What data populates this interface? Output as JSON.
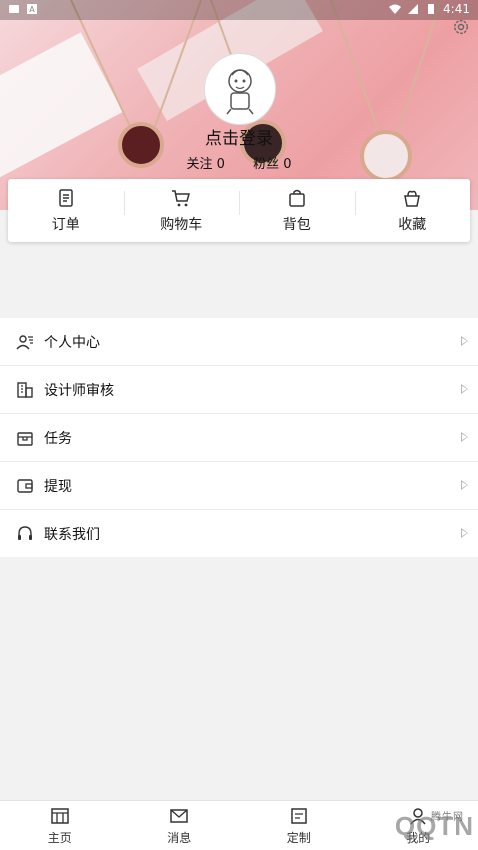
{
  "status_bar": {
    "time": "4:41"
  },
  "profile": {
    "login_text": "点击登录",
    "follow_label": "关注",
    "follow_count": "0",
    "fans_label": "粉丝",
    "fans_count": "0"
  },
  "quick_actions": [
    {
      "label": "订单",
      "icon": "order-icon"
    },
    {
      "label": "购物车",
      "icon": "cart-icon"
    },
    {
      "label": "背包",
      "icon": "bag-icon"
    },
    {
      "label": "收藏",
      "icon": "favorite-icon"
    }
  ],
  "menu": [
    {
      "label": "个人中心",
      "icon": "profile-card-icon"
    },
    {
      "label": "设计师审核",
      "icon": "building-icon"
    },
    {
      "label": "任务",
      "icon": "box-icon"
    },
    {
      "label": "提现",
      "icon": "wallet-icon"
    },
    {
      "label": "联系我们",
      "icon": "headset-icon"
    }
  ],
  "bottom_nav": [
    {
      "label": "主页",
      "icon": "home-icon"
    },
    {
      "label": "消息",
      "icon": "message-icon"
    },
    {
      "label": "定制",
      "icon": "custom-icon"
    },
    {
      "label": "我的",
      "icon": "user-icon"
    }
  ],
  "watermark": {
    "text": "QQTN",
    "sub": "腾牛网"
  }
}
